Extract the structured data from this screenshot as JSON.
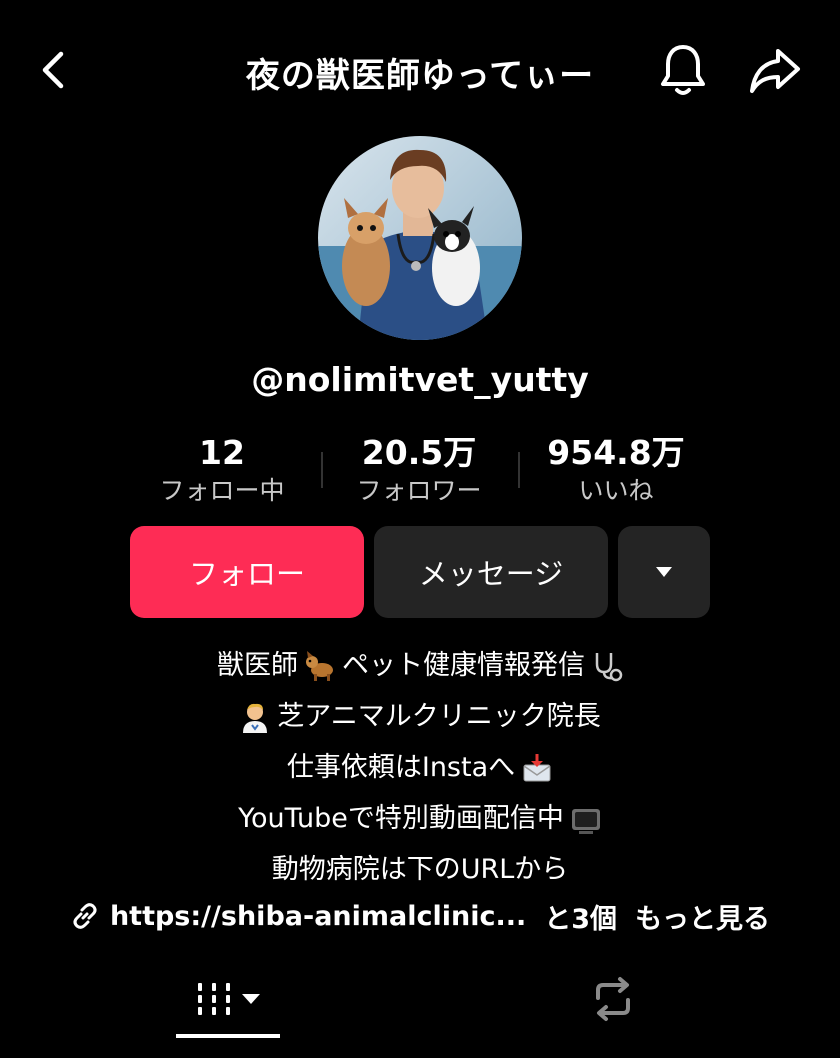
{
  "header": {
    "title": "夜の獣医師ゆってぃー",
    "back_icon": "chevron-left-icon",
    "bell_icon": "bell-icon",
    "share_icon": "share-arrow-icon"
  },
  "profile": {
    "username": "@nolimitvet_yutty",
    "avatar_alt": "avatar"
  },
  "stats": [
    {
      "value": "12",
      "label": "フォロー中"
    },
    {
      "value": "20.5万",
      "label": "フォロワー"
    },
    {
      "value": "954.8万",
      "label": "いいね"
    }
  ],
  "actions": {
    "follow_label": "フォロー",
    "message_label": "メッセージ"
  },
  "bio": {
    "line1": "獣医師",
    "line1b": "ペット健康情報発信",
    "line2": "芝アニマルクリニック院長",
    "line3": "仕事依頼はInstaへ",
    "line4": "YouTubeで特別動画配信中",
    "line5": "動物病院は下のURLから"
  },
  "link": {
    "url": "https://shiba-animalclinic...",
    "extra": "と3個",
    "more": "もっと見る"
  },
  "colors": {
    "accent": "#fe2c55",
    "button_bg": "#242424",
    "background": "#000000"
  }
}
